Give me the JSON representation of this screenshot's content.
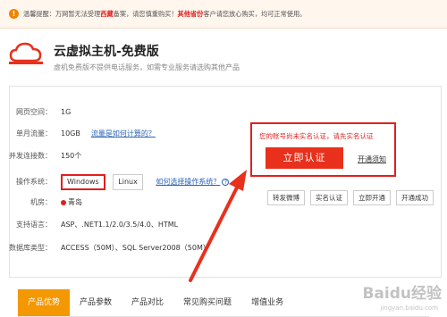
{
  "notice": {
    "prefix": "温馨提醒：万网暂无法受理",
    "highlight1": "西藏",
    "middle": "备案，请您慎重购买！",
    "highlight2": "其他省份",
    "suffix": "客户请您放心购买，均可正常使用。"
  },
  "header": {
    "title": "云虚拟主机-免费版",
    "subtitle": "虚机免费版不提供电话服务，如需专业服务请选购其他产品"
  },
  "specs": [
    {
      "label": "网页空间：",
      "value": "1G"
    },
    {
      "label": "单月流量：",
      "value": "10GB",
      "link": "流量是如何计算的？"
    },
    {
      "label": "并发连接数：",
      "value": "150个"
    },
    {
      "label": "操作系统："
    },
    {
      "label": "机房：",
      "value": "青岛"
    },
    {
      "label": "支持语言：",
      "value": "ASP、.NET1.1/2.0/3.5/4.0、HTML"
    },
    {
      "label": "数据库类型：",
      "value": "ACCESS（50M）、SQL Server2008（50M）"
    }
  ],
  "os": {
    "options": [
      "Windows",
      "Linux"
    ],
    "selected": "Windows",
    "help_link": "如何选择操作系统？"
  },
  "auth": {
    "message": "您的账号尚未实名认证，请先实名认证",
    "button": "立即认证",
    "guide_link": "开通须知"
  },
  "steps": [
    "转发微博",
    "实名认证",
    "立即开通",
    "开通成功"
  ],
  "tabs": [
    {
      "label": "产品优势",
      "active": true
    },
    {
      "label": "产品参数"
    },
    {
      "label": "产品对比"
    },
    {
      "label": "常见购买问题"
    },
    {
      "label": "增值业务"
    }
  ],
  "watermark": {
    "main": "Baidu经验",
    "sub": "jingyan.baidu.com"
  },
  "colors": {
    "accent_red": "#e0201e",
    "tab_orange": "#f39800",
    "link_blue": "#2a63b9"
  }
}
